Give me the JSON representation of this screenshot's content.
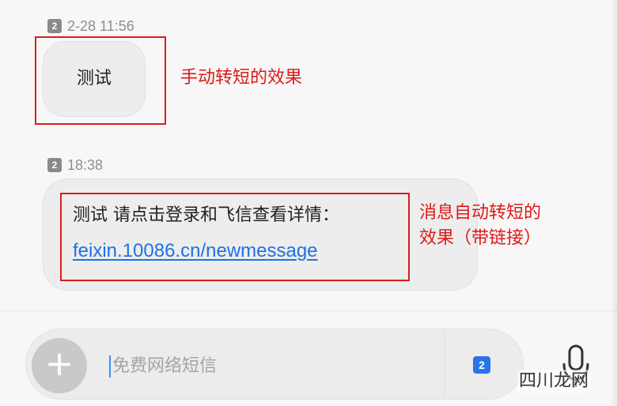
{
  "messages": [
    {
      "sim": "2",
      "timestamp": "2-28 11:56",
      "text": "测试",
      "annotation": "手动转短的效果"
    },
    {
      "sim": "2",
      "timestamp": "18:38",
      "text": "测试 请点击登录和飞信查看详情：",
      "link": "feixin.10086.cn/newmessage",
      "annotation_line1": "消息自动转短的",
      "annotation_line2": "效果（带链接）"
    }
  ],
  "composer": {
    "plus_glyph": "+",
    "placeholder": "免费网络短信",
    "send_sim": "2",
    "mic_icon": "microphone-icon"
  },
  "watermark": "四川龙网",
  "colors": {
    "annotation_red": "#e01818",
    "link_blue": "#1d71e8",
    "bubble_bg": "#ededed",
    "accent_blue": "#2a73e8"
  }
}
